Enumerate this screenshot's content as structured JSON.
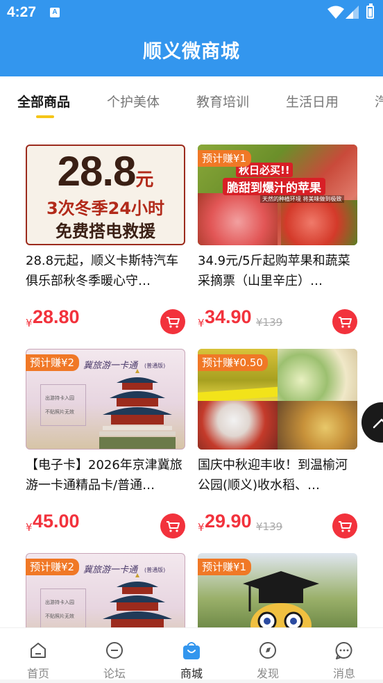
{
  "status_bar": {
    "time": "4:27",
    "notification_icon": "A"
  },
  "header": {
    "title": "顺义微商城"
  },
  "tabs": [
    {
      "label": "全部商品",
      "active": true
    },
    {
      "label": "个护美体",
      "active": false
    },
    {
      "label": "教育培训",
      "active": false
    },
    {
      "label": "生活日用",
      "active": false
    },
    {
      "label": "汽",
      "active": false
    }
  ],
  "products": [
    {
      "image_text": {
        "big": "28.8",
        "unit": "元",
        "line2": "3次冬季24小时",
        "line3": "免费搭电救援"
      },
      "name": "28.8元起，顺义卡斯特汽车俱乐部秋冬季暖心守…",
      "currency": "¥",
      "price": "28.80",
      "original_price": "",
      "badge": ""
    },
    {
      "image_text": {
        "banner1": "秋日必买!!",
        "banner2": "脆甜到爆汁的苹果",
        "banner3": "天然的种植环境 将美味做到极致"
      },
      "name": "34.9元/5斤起购苹果和蔬菜采摘票（山里辛庄）…",
      "currency": "¥",
      "price": "34.90",
      "original_price": "¥139",
      "badge": "预计赚¥1"
    },
    {
      "image_text": {
        "card_title": "冀旅游一卡通",
        "card_sub": "(普通版)",
        "line1": "出游持卡入园",
        "line2": "不贴照片无效"
      },
      "name": "【电子卡】2026年京津冀旅游一卡通精品卡/普通…",
      "currency": "¥",
      "price": "45.00",
      "original_price": "",
      "badge": "预计赚¥2"
    },
    {
      "image_text": {},
      "name": "国庆中秋迎丰收！到温榆河公园(顺义)收水稻、…",
      "currency": "¥",
      "price": "29.90",
      "original_price": "¥139",
      "badge": "预计赚¥0.50"
    },
    {
      "image_text": {
        "card_title": "冀旅游一卡通",
        "card_sub": "(普通版)",
        "line1": "出游持卡入园",
        "line2": "不贴照片无效"
      },
      "name": "",
      "currency": "",
      "price": "",
      "original_price": "",
      "badge": "预计赚¥2"
    },
    {
      "image_text": {},
      "name": "",
      "currency": "",
      "price": "",
      "original_price": "",
      "badge": "预计赚¥1"
    }
  ],
  "bottom_nav": [
    {
      "label": "首页",
      "icon": "home-icon",
      "active": false
    },
    {
      "label": "论坛",
      "icon": "forum-icon",
      "active": false
    },
    {
      "label": "商城",
      "icon": "shopping-bag-icon",
      "active": true
    },
    {
      "label": "发现",
      "icon": "discover-icon",
      "active": false
    },
    {
      "label": "消息",
      "icon": "message-icon",
      "active": false
    }
  ],
  "colors": {
    "primary": "#3396ee",
    "price": "#f2323c",
    "badge": "#f07826",
    "tab_indicator": "#f5c518"
  }
}
